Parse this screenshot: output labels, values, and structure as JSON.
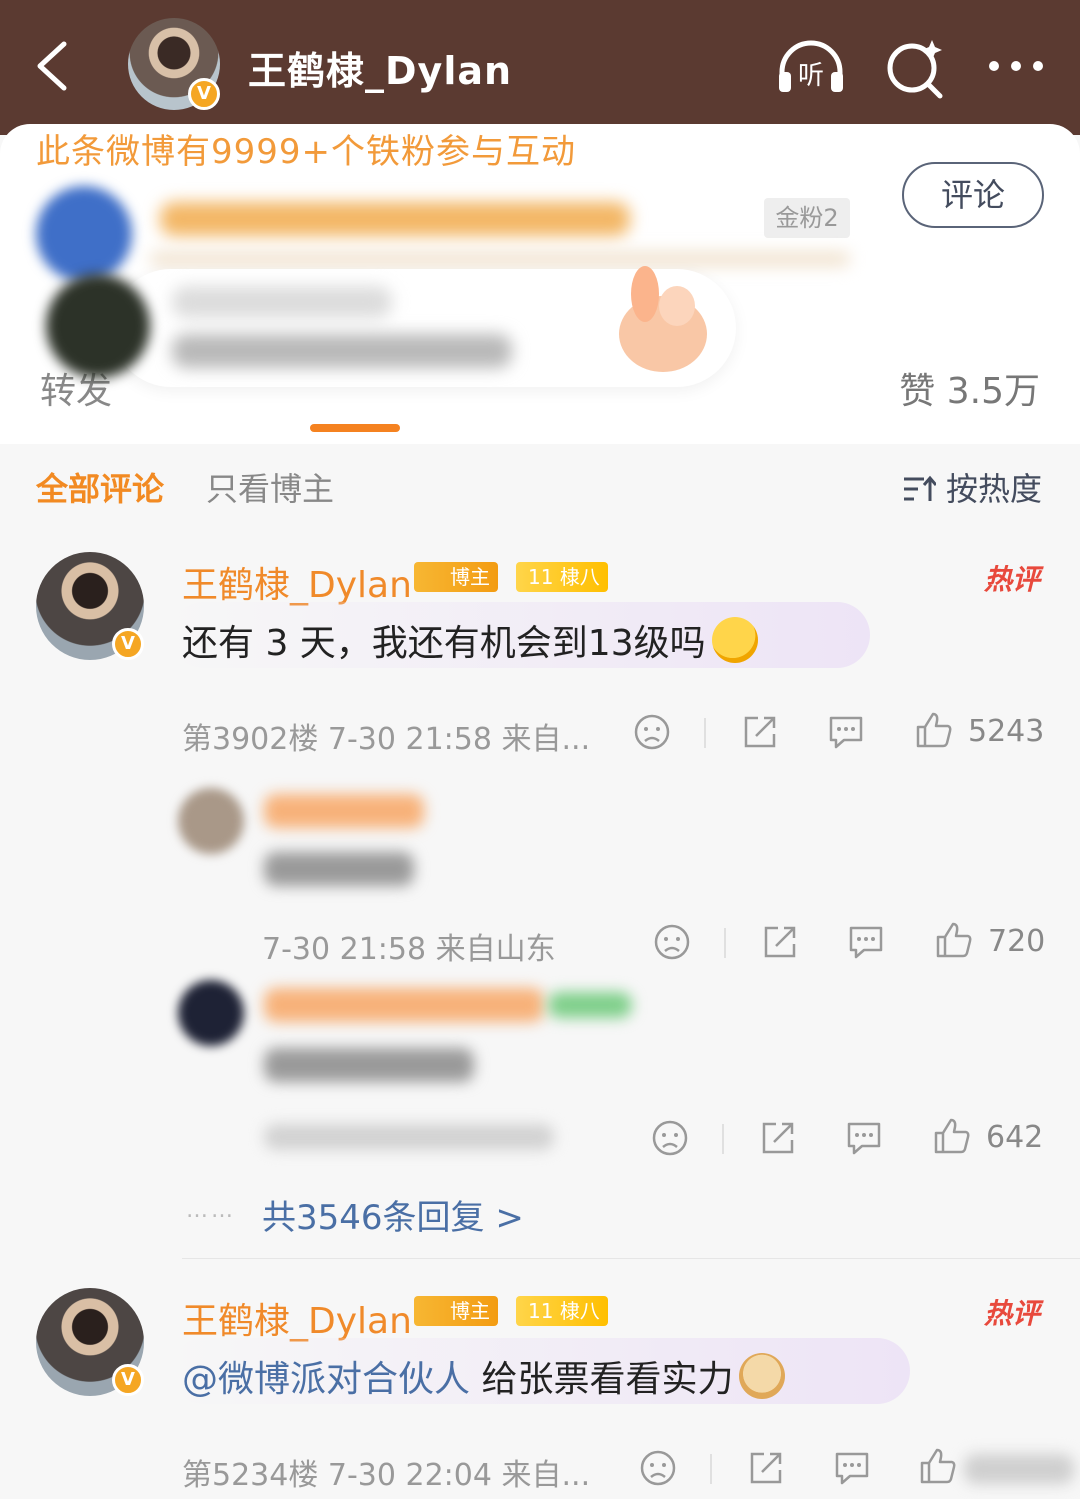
{
  "header": {
    "title": "王鹤棣_Dylan",
    "verified": "V",
    "icons": [
      "back-icon",
      "listen-icon",
      "search-icon",
      "more-icon"
    ],
    "listen_label": "听"
  },
  "popup": {
    "promo": "此条微博有9999+个铁粉参与互动",
    "comment_button": "评论",
    "fan_tag": "金粉2"
  },
  "stats": {
    "repost": "转发",
    "likes": "赞 3.5万"
  },
  "filter": {
    "all": "全部评论",
    "owner_only": "只看博主",
    "sort": "按热度"
  },
  "comments": [
    {
      "name": "王鹤棣_Dylan",
      "badge_host": "博主",
      "badge_level_num": "11",
      "badge_level": "棣八",
      "hot": "热评",
      "text": "还有 3 天，我还有机会到13级吗",
      "meta": "第3902楼 7-30 21:58 来自...",
      "likes": "5243",
      "replies": [
        {
          "meta": "7-30 21:58 来自山东",
          "likes": "720"
        },
        {
          "meta": "",
          "likes": "642"
        }
      ],
      "more_replies": "共3546条回复 >",
      "more_dots": "……"
    },
    {
      "name": "王鹤棣_Dylan",
      "badge_host": "博主",
      "badge_level_num": "11",
      "badge_level": "棣八",
      "hot": "热评",
      "mention": "@微博派对合伙人",
      "text": " 给张票看看实力",
      "meta": "第5234楼 7-30 22:04 来自..."
    }
  ],
  "colors": {
    "header_bg": "#5b3a31",
    "accent_orange": "#f28a22",
    "link_blue": "#4a6fa5",
    "hot_red": "#e8493c"
  }
}
